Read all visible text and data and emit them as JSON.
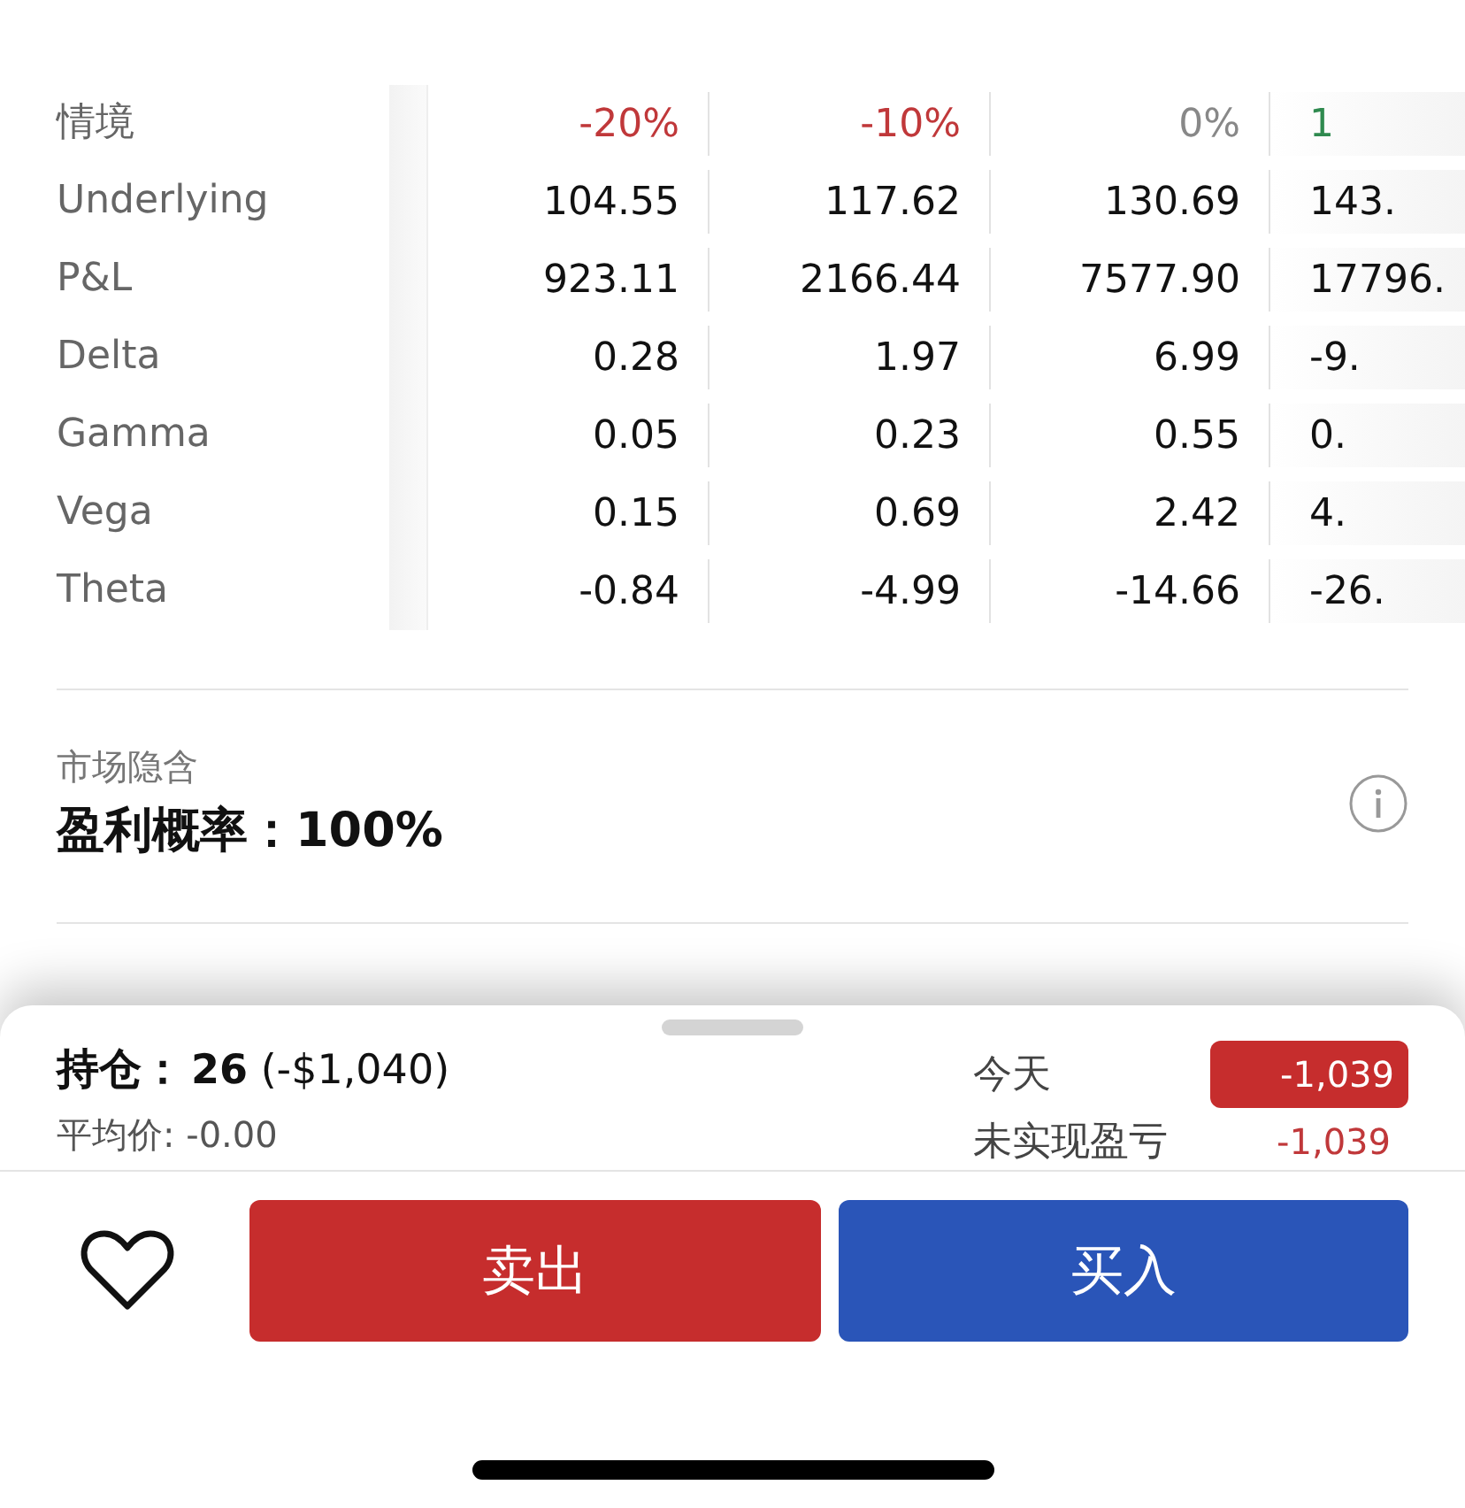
{
  "scenario_table": {
    "corner_label": "情境",
    "row_labels": [
      "Underlying",
      "P&L",
      "Delta",
      "Gamma",
      "Vega",
      "Theta"
    ],
    "columns": [
      {
        "header": "-20%",
        "kind": "down",
        "values": [
          "104.55",
          "923.11",
          "0.28",
          "0.05",
          "0.15",
          "-0.84"
        ]
      },
      {
        "header": "-10%",
        "kind": "down",
        "values": [
          "117.62",
          "2166.44",
          "1.97",
          "0.23",
          "0.69",
          "-4.99"
        ]
      },
      {
        "header": "0%",
        "kind": "flat",
        "values": [
          "130.69",
          "7577.90",
          "6.99",
          "0.55",
          "2.42",
          "-14.66"
        ]
      },
      {
        "header": "1",
        "kind": "up",
        "values": [
          "143.",
          "17796.",
          "-9.",
          "0.",
          "4.",
          "-26."
        ]
      }
    ]
  },
  "market_implied": {
    "caption": "市场隐含",
    "label": "盈利概率：",
    "value": "100%"
  },
  "position_sheet": {
    "position_label": "持仓：",
    "position_value": "**26** (-$1,040)",
    "avg_price": "平均价: -0.00",
    "stats": [
      {
        "label": "今天",
        "value": "-1,039",
        "kind": "badge"
      },
      {
        "label": "未实现盈亏",
        "value": "-1,039",
        "kind": "plain"
      }
    ],
    "favorite": {
      "on": false
    },
    "buttons": [
      {
        "label": "卖出",
        "kind": "sell"
      },
      {
        "label": "买入",
        "kind": "buy"
      }
    ]
  }
}
